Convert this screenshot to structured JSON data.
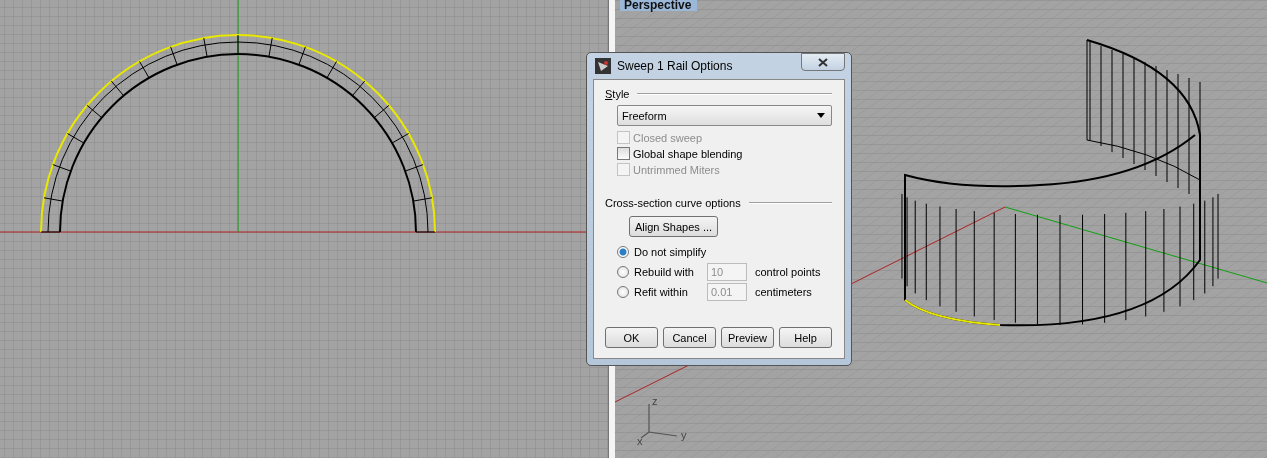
{
  "viewports": [
    {
      "kind": "top"
    },
    {
      "kind": "perspective",
      "label": "Perspective",
      "axis_labels": [
        "z",
        "y",
        "x"
      ]
    }
  ],
  "dialog": {
    "title": "Sweep 1 Rail Options",
    "style_section": {
      "heading": "Style",
      "dropdown": {
        "value": "Freeform"
      },
      "checkboxes": [
        {
          "label": "Closed sweep",
          "checked": false,
          "disabled": true
        },
        {
          "label": "Global shape blending",
          "checked": false,
          "disabled": false
        },
        {
          "label": "Untrimmed Miters",
          "checked": false,
          "disabled": true
        }
      ]
    },
    "cross_section": {
      "heading": "Cross-section curve options",
      "align_button": "Align Shapes ...",
      "options": [
        {
          "label": "Do not simplify",
          "selected": true
        },
        {
          "label": "Rebuild with",
          "selected": false,
          "value": "10",
          "unit": "control points"
        },
        {
          "label": "Refit within",
          "selected": false,
          "value": "0.01",
          "unit": "centimeters"
        }
      ]
    },
    "buttons": [
      "OK",
      "Cancel",
      "Preview",
      "Help"
    ]
  }
}
